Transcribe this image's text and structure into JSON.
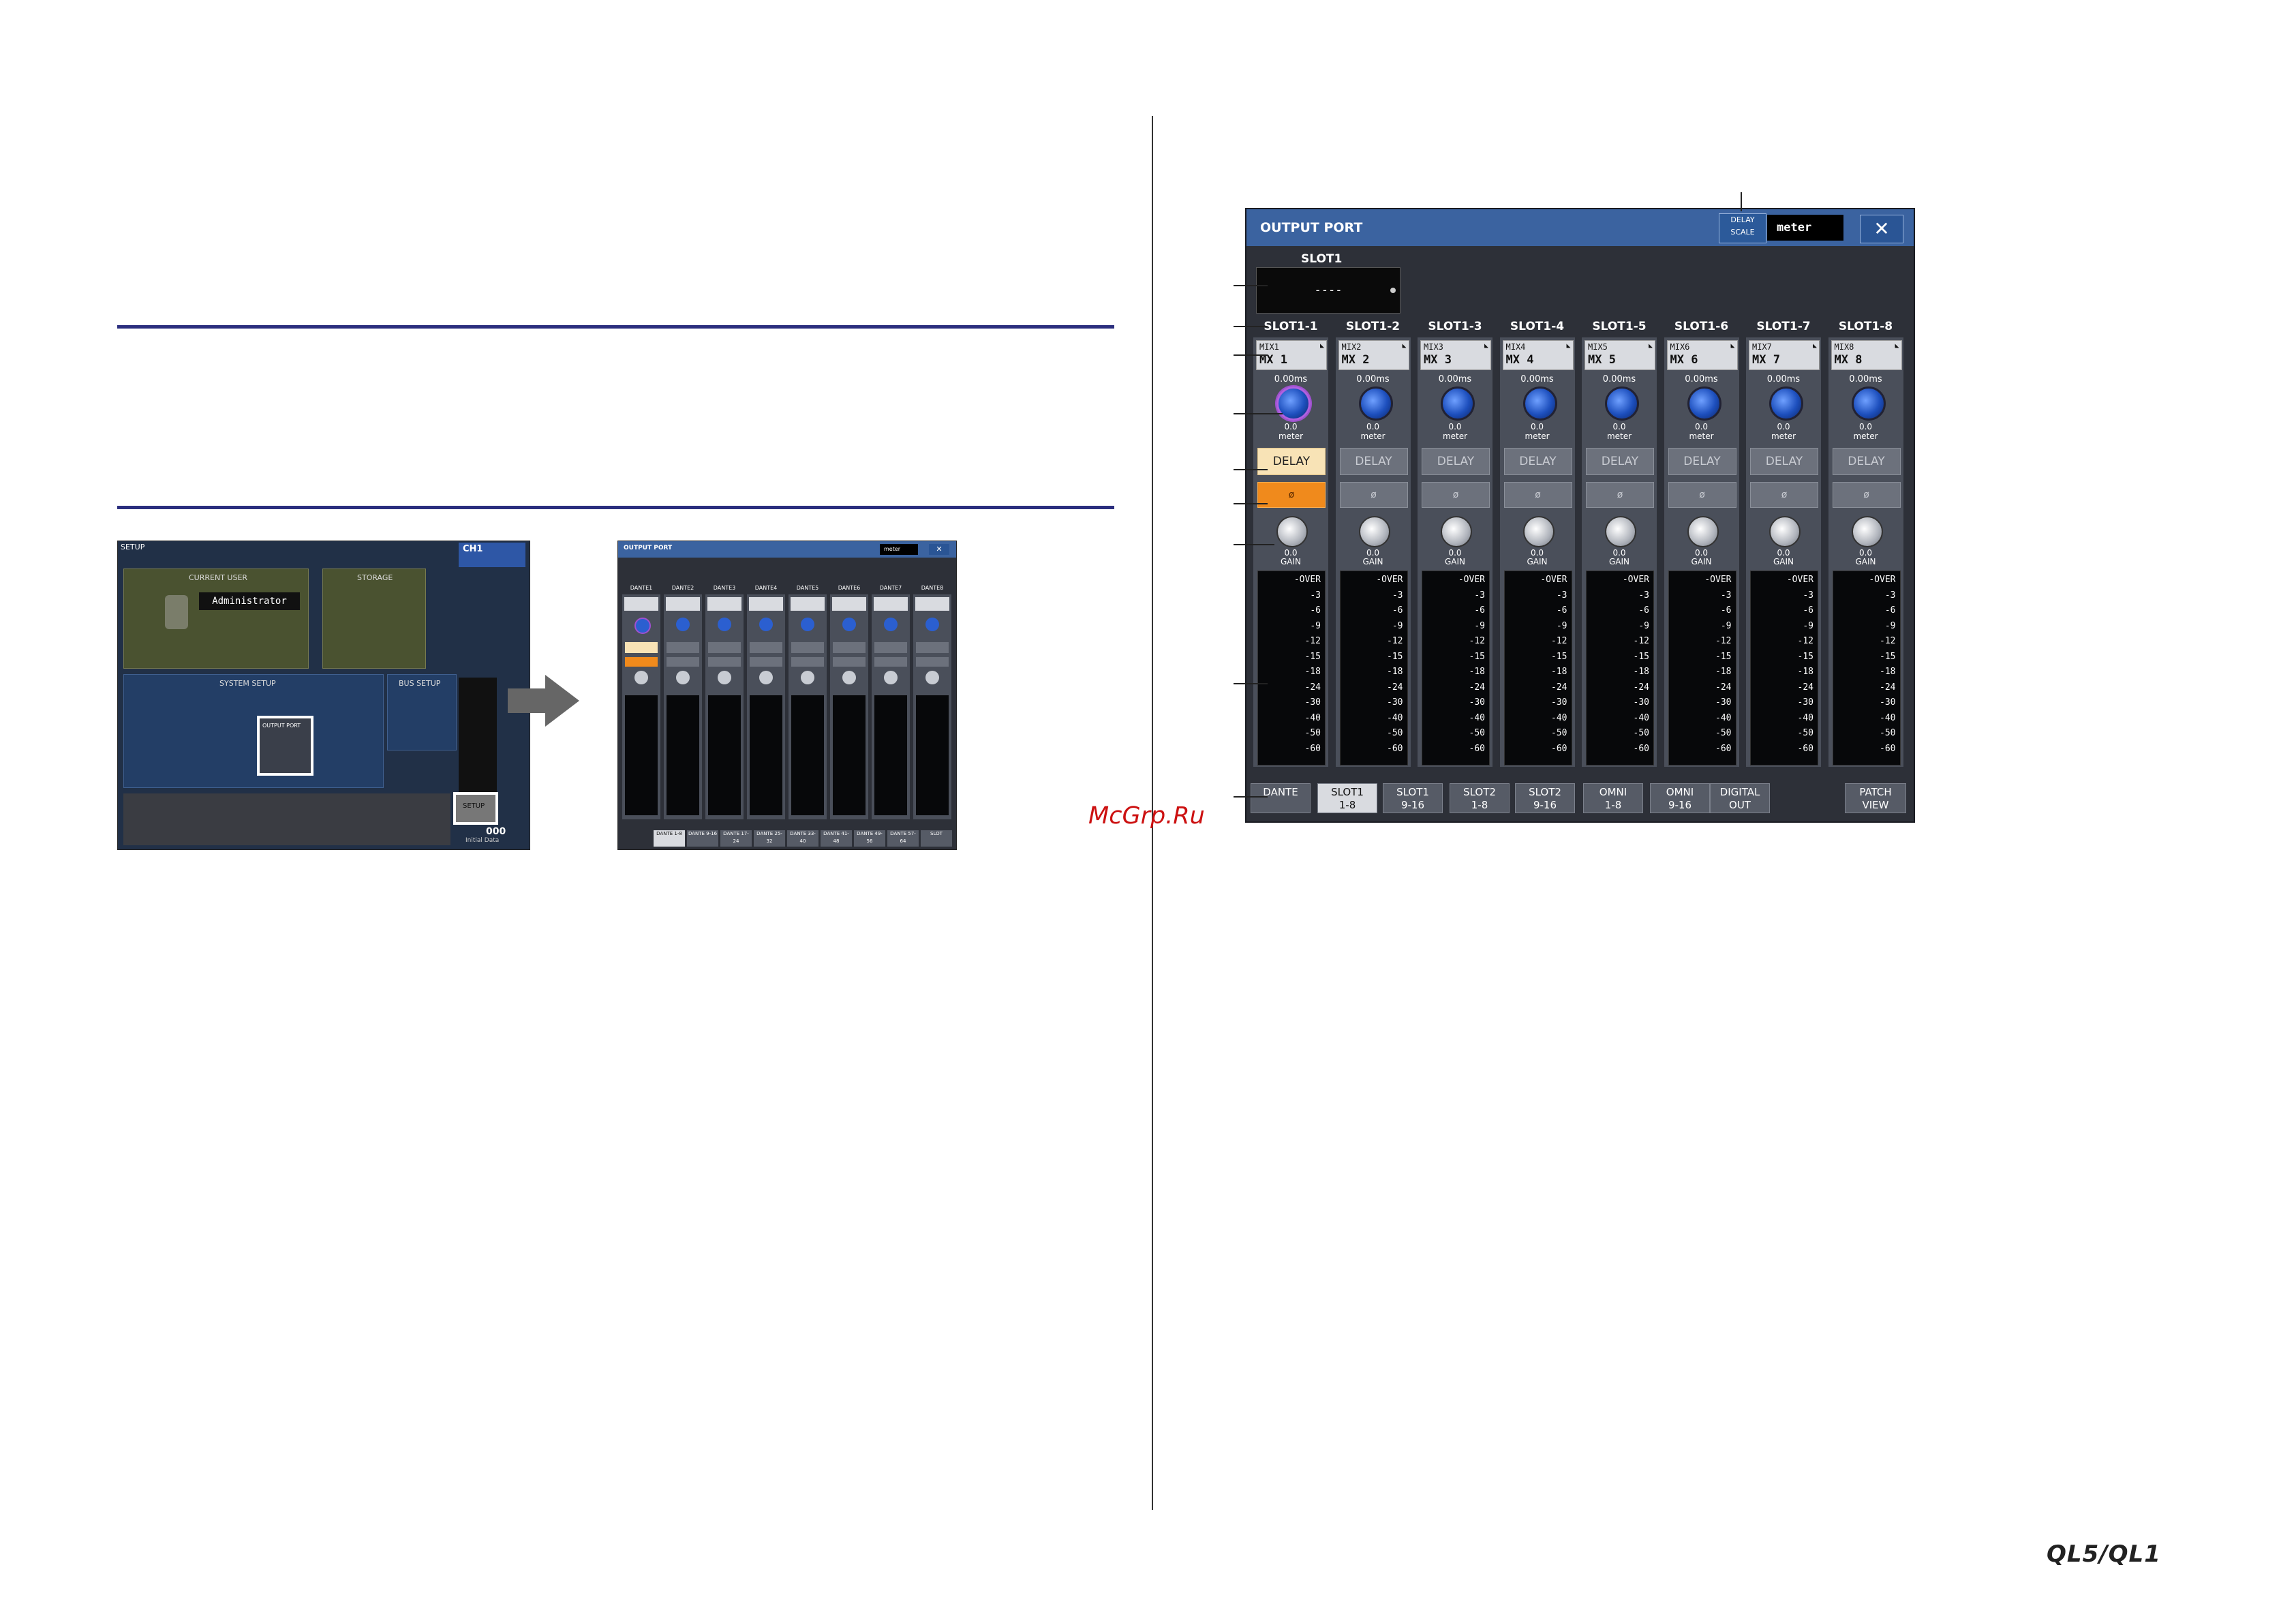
{
  "watermark": "McGrp.Ru",
  "logo": "QL5/QL1",
  "setup_shot": {
    "title": "SETUP",
    "current_user": "CURRENT USER",
    "user_name": "Administrator",
    "storage": "STORAGE",
    "system_setup": "SYSTEM SETUP",
    "bus_setup": "BUS SETUP",
    "output_port": "OUTPUT PORT",
    "setup_button": "SETUP",
    "channel": "CH1",
    "scene": "000",
    "scene_name": "Initial Data"
  },
  "small_output": {
    "title": "OUTPUT PORT",
    "meter": "meter",
    "columns": [
      "DANTE1",
      "DANTE2",
      "DANTE3",
      "DANTE4",
      "DANTE5",
      "DANTE6",
      "DANTE7",
      "DANTE8"
    ],
    "tabs": [
      "DANTE 1-8",
      "DANTE 9-16",
      "DANTE 17-24",
      "DANTE 25-32",
      "DANTE 33-40",
      "DANTE 41-48",
      "DANTE 49-56",
      "DANTE 57-64",
      "SLOT"
    ]
  },
  "window": {
    "title": "OUTPUT PORT",
    "delay_scale": "DELAY SCALE",
    "delay_scale_value": "meter",
    "close": "✕",
    "slot_heading": "SLOT1",
    "slot_value": "----"
  },
  "channels": [
    {
      "label": "SLOT1-1",
      "mix_top": "MIX1",
      "mix_name": "MX 1",
      "delay_ms": "0.00ms",
      "knob_val": "0.0",
      "knob_unit": "meter",
      "delay_on": true,
      "phase_on": true,
      "gain": "0.0"
    },
    {
      "label": "SLOT1-2",
      "mix_top": "MIX2",
      "mix_name": "MX 2",
      "delay_ms": "0.00ms",
      "knob_val": "0.0",
      "knob_unit": "meter",
      "delay_on": false,
      "phase_on": false,
      "gain": "0.0"
    },
    {
      "label": "SLOT1-3",
      "mix_top": "MIX3",
      "mix_name": "MX 3",
      "delay_ms": "0.00ms",
      "knob_val": "0.0",
      "knob_unit": "meter",
      "delay_on": false,
      "phase_on": false,
      "gain": "0.0"
    },
    {
      "label": "SLOT1-4",
      "mix_top": "MIX4",
      "mix_name": "MX 4",
      "delay_ms": "0.00ms",
      "knob_val": "0.0",
      "knob_unit": "meter",
      "delay_on": false,
      "phase_on": false,
      "gain": "0.0"
    },
    {
      "label": "SLOT1-5",
      "mix_top": "MIX5",
      "mix_name": "MX 5",
      "delay_ms": "0.00ms",
      "knob_val": "0.0",
      "knob_unit": "meter",
      "delay_on": false,
      "phase_on": false,
      "gain": "0.0"
    },
    {
      "label": "SLOT1-6",
      "mix_top": "MIX6",
      "mix_name": "MX 6",
      "delay_ms": "0.00ms",
      "knob_val": "0.0",
      "knob_unit": "meter",
      "delay_on": false,
      "phase_on": false,
      "gain": "0.0"
    },
    {
      "label": "SLOT1-7",
      "mix_top": "MIX7",
      "mix_name": "MX 7",
      "delay_ms": "0.00ms",
      "knob_val": "0.0",
      "knob_unit": "meter",
      "delay_on": false,
      "phase_on": false,
      "gain": "0.0"
    },
    {
      "label": "SLOT1-8",
      "mix_top": "MIX8",
      "mix_name": "MX 8",
      "delay_ms": "0.00ms",
      "knob_val": "0.0",
      "knob_unit": "meter",
      "delay_on": false,
      "phase_on": false,
      "gain": "0.0"
    }
  ],
  "strip_labels": {
    "delay": "DELAY",
    "phase": "ø",
    "gain": "GAIN"
  },
  "meter_scale": [
    "-OVER",
    "-3",
    "-6",
    "-9",
    "-12",
    "-15",
    "-18",
    "-24",
    "-30",
    "-40",
    "-50",
    "-60"
  ],
  "tabs": [
    {
      "line1": "DANTE",
      "line2": "",
      "selected": false
    },
    {
      "line1": "SLOT1",
      "line2": "1-8",
      "selected": true
    },
    {
      "line1": "SLOT1",
      "line2": "9-16",
      "selected": false
    },
    {
      "line1": "SLOT2",
      "line2": "1-8",
      "selected": false
    },
    {
      "line1": "SLOT2",
      "line2": "9-16",
      "selected": false
    },
    {
      "line1": "OMNI",
      "line2": "1-8",
      "selected": false
    },
    {
      "line1": "OMNI",
      "line2": "9-16",
      "selected": false
    },
    {
      "line1": "DIGITAL",
      "line2": "OUT",
      "selected": false
    },
    {
      "line1": "PATCH",
      "line2": "VIEW",
      "selected": false
    }
  ]
}
